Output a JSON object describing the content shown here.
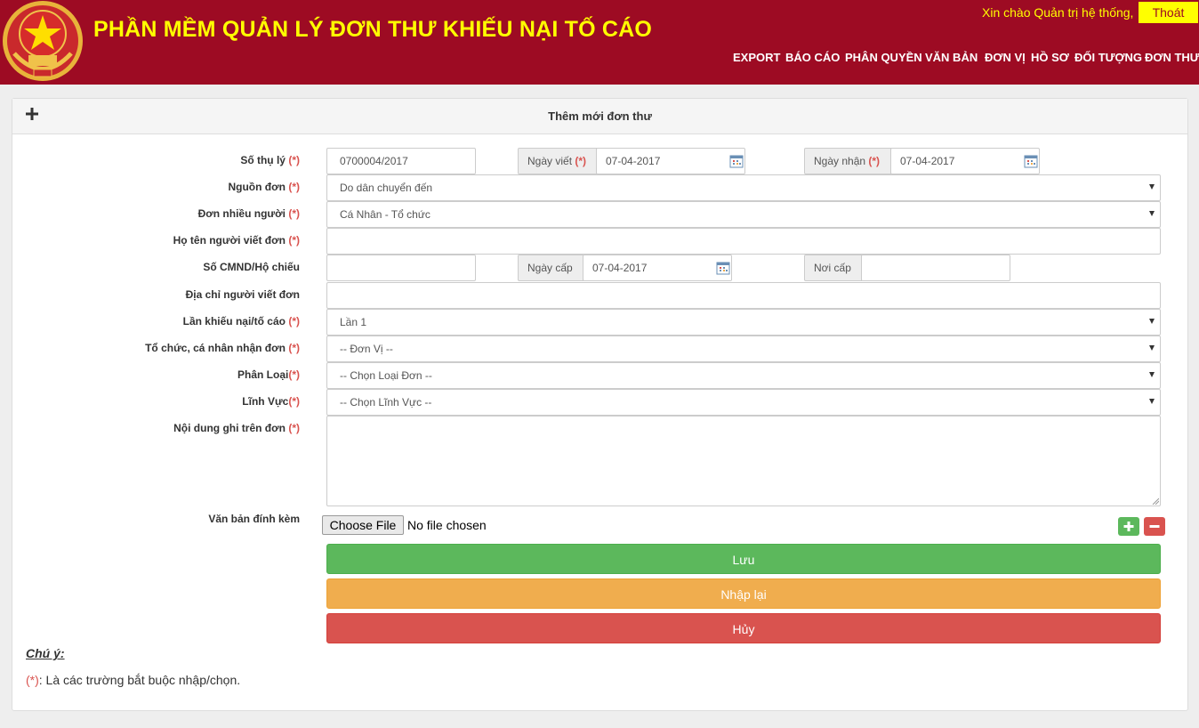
{
  "header": {
    "title": "PHẦN MỀM QUẢN LÝ ĐƠN THƯ KHIẾU NẠI TỐ CÁO",
    "greeting": "Xin chào Quản trị hệ thống,",
    "logout_label": "Thoát",
    "nav": [
      "EXPORT",
      "BÁO CÁO",
      "PHÂN QUYỀN",
      "VĂN BẢN",
      "ĐƠN VỊ",
      "HỒ SƠ",
      "ĐỐI TƯỢNG",
      "ĐƠN THƯ"
    ],
    "colors": {
      "brand": "#9d0b23",
      "title": "#ffff00"
    }
  },
  "panel": {
    "title": "Thêm mới đơn thư",
    "required_mark": "(*)"
  },
  "form": {
    "so_thu_ly": {
      "label": "Số thụ lý",
      "value": "0700004/2017"
    },
    "ngay_viet": {
      "label": "Ngày viết",
      "value": "07-04-2017"
    },
    "ngay_nhan": {
      "label": "Ngày nhận",
      "value": "07-04-2017"
    },
    "nguon_don": {
      "label": "Nguồn đơn",
      "value": "Do dân chuyển đến"
    },
    "don_nhieu_nguoi": {
      "label": "Đơn nhiều người",
      "value": "Cá Nhân - Tổ chức"
    },
    "ho_ten": {
      "label": "Họ tên người viết đơn",
      "value": ""
    },
    "cmnd": {
      "label": "Số CMND/Hộ chiếu",
      "value": ""
    },
    "ngay_cap": {
      "label": "Ngày cấp",
      "value": "07-04-2017"
    },
    "noi_cap": {
      "label": "Nơi cấp",
      "value": ""
    },
    "dia_chi": {
      "label": "Địa chỉ người viết đơn",
      "value": ""
    },
    "lan_khieu_nai": {
      "label": "Lần khiếu nại/tố cáo",
      "value": "Lần 1"
    },
    "to_chuc": {
      "label": "Tổ chức, cá nhân nhận đơn",
      "value": "-- Đơn Vị --"
    },
    "phan_loai": {
      "label": "Phân Loại",
      "value": "-- Chọn Loại Đơn --"
    },
    "linh_vuc": {
      "label": "Lĩnh Vực",
      "value": "-- Chọn Lĩnh Vực --"
    },
    "noi_dung": {
      "label": "Nội dung ghi trên đơn",
      "value": ""
    },
    "van_ban": {
      "label": "Văn bản đính kèm",
      "button": "Choose File",
      "status": "No file chosen"
    }
  },
  "actions": {
    "save": "Lưu",
    "reset": "Nhập lại",
    "cancel": "Hủy"
  },
  "note": {
    "title": "Chú ý:",
    "mark": "(*)",
    "text": ": Là các trường bắt buộc nhập/chọn."
  }
}
